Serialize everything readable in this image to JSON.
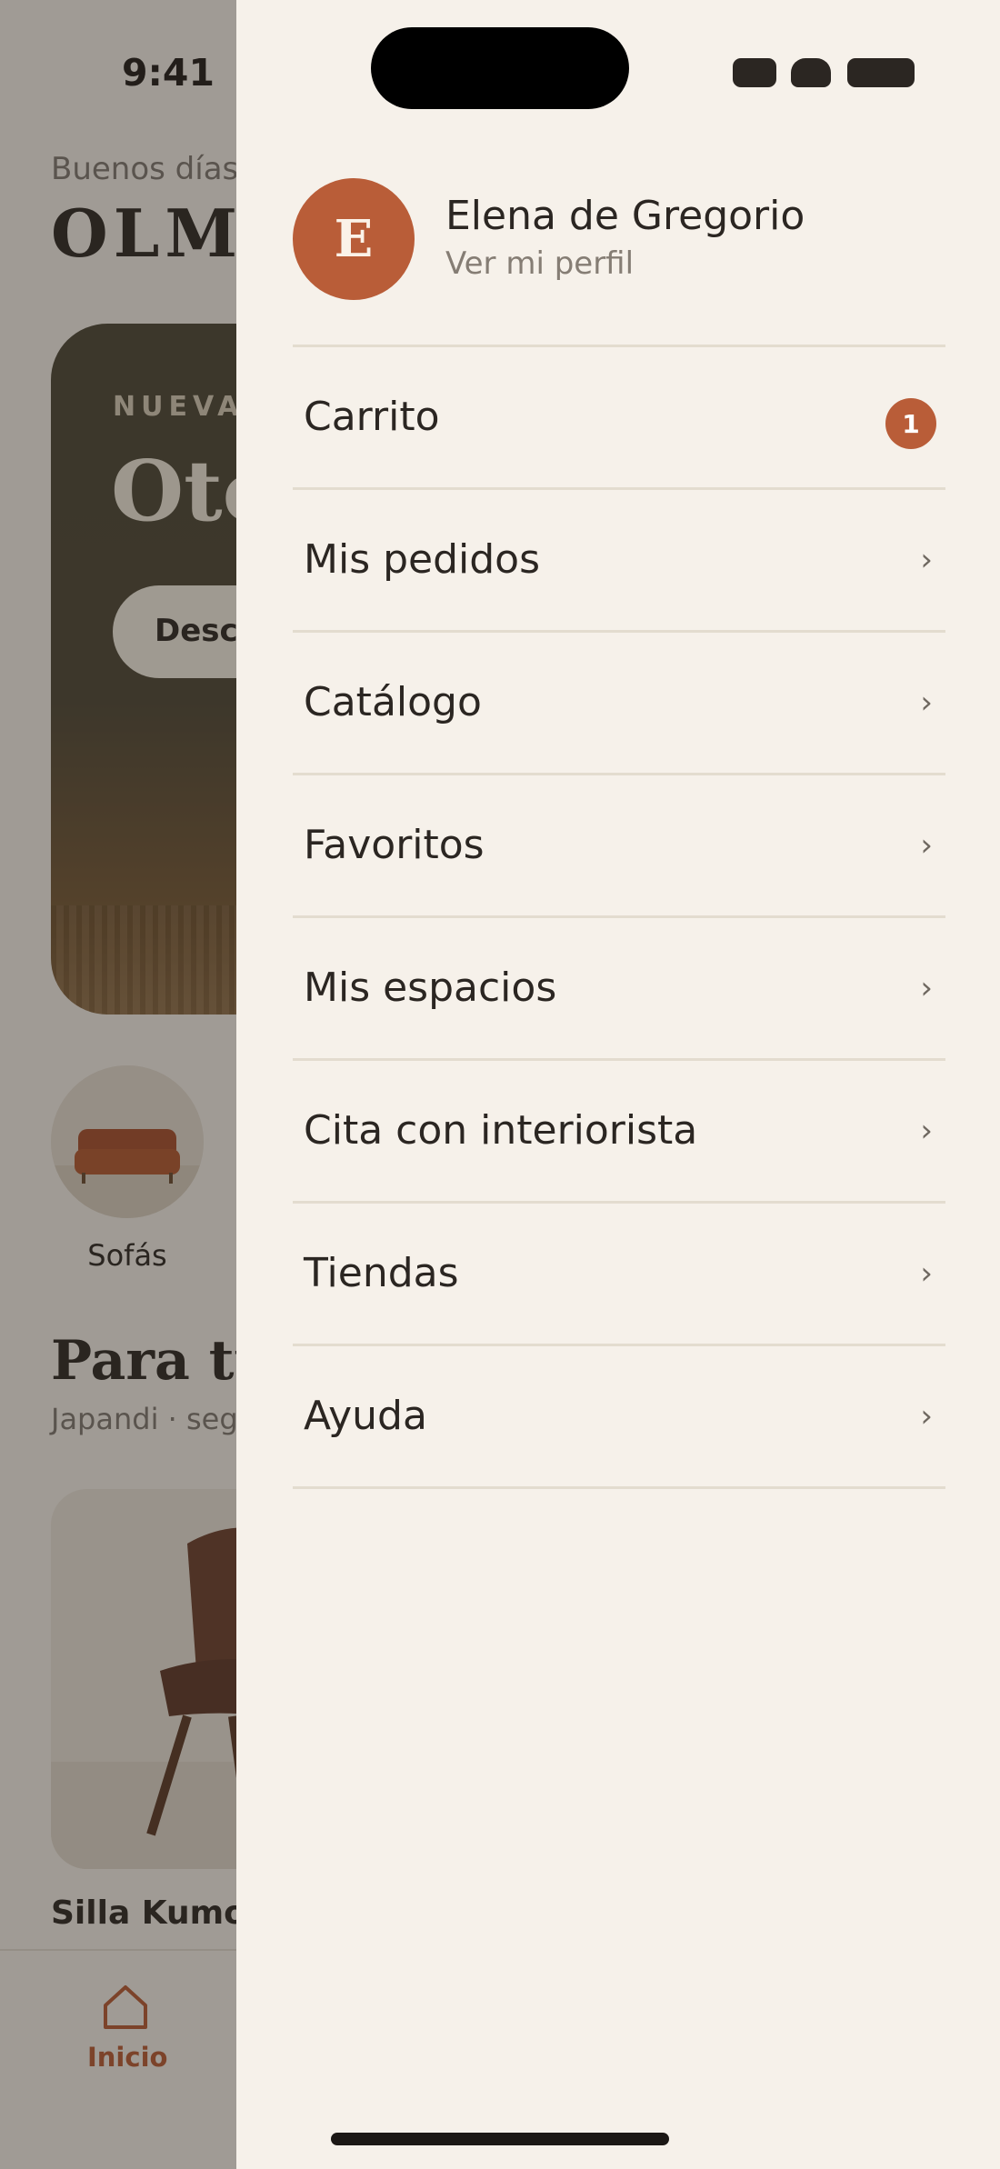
{
  "status_bar": {
    "time": "9:41"
  },
  "home": {
    "greeting": "Buenos días,",
    "brand": "OLMO",
    "hero": {
      "eyebrow": "NUEVA",
      "title": "Oto",
      "button_label": "Desc"
    },
    "categories": [
      {
        "label": "Sofás"
      }
    ],
    "section": {
      "title": "Para tu",
      "subtitle": "Japandi · seg"
    },
    "product": {
      "name": "Silla Kumo"
    },
    "tab_bar": {
      "active_tab": "Inicio"
    }
  },
  "drawer": {
    "profile": {
      "initial": "E",
      "name": "Elena de Gregorio",
      "link": "Ver mi perfil"
    },
    "menu": [
      {
        "label": "Carrito",
        "badge": "1"
      },
      {
        "label": "Mis pedidos"
      },
      {
        "label": "Catálogo"
      },
      {
        "label": "Favoritos"
      },
      {
        "label": "Mis espacios"
      },
      {
        "label": "Cita con interiorista"
      },
      {
        "label": "Tiendas"
      },
      {
        "label": "Ayuda"
      }
    ],
    "chevron_glyph": "›"
  },
  "colors": {
    "accent": "#b95d38",
    "background": "#f6f1ea",
    "text": "#2b2622",
    "muted_text": "#857d74",
    "divider": "#e3dccf"
  },
  "icons": [
    "home-icon",
    "chevron-right-icon",
    "signal-icon",
    "wifi-icon",
    "battery-icon"
  ]
}
